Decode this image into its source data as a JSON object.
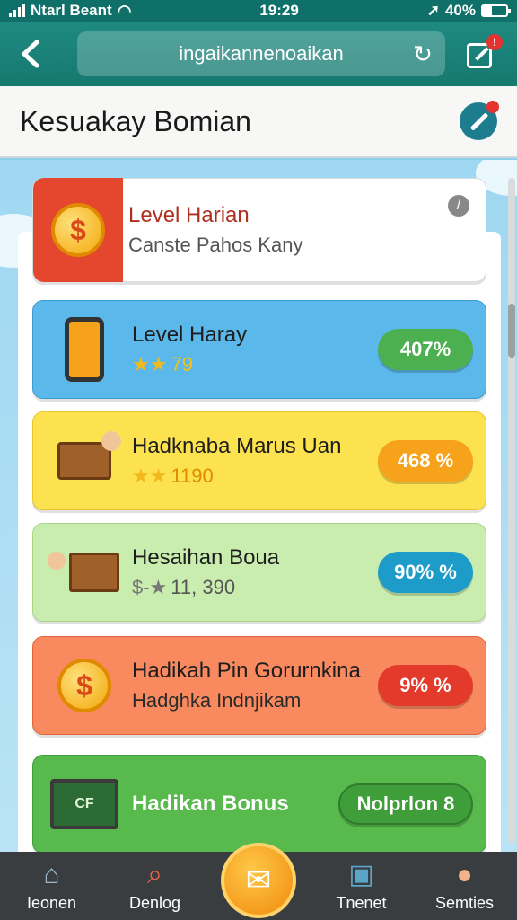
{
  "status_bar": {
    "carrier": "Ntarl Beant",
    "time": "19:29",
    "battery": "40%",
    "battery_level": 0.4
  },
  "browser": {
    "url": "ingaikannenoaikan"
  },
  "header": {
    "title": "Kesuakay  Bomian"
  },
  "cards": [
    {
      "name": "Level Harian",
      "sub": "Canste Pahos Kany",
      "badge": "",
      "color": "#ffffff",
      "pill_color": ""
    },
    {
      "name": "Level Haray",
      "stars": "★★",
      "sub": "79",
      "badge": "407%",
      "color": "#5bb8ea",
      "pill_color": "#4caf50"
    },
    {
      "name": "Hadknaba Marus Uan",
      "stars": "★★",
      "sub": "1190",
      "badge": "468 %",
      "color": "#fde24f",
      "pill_color": "#f7a21b"
    },
    {
      "name": "Hesaihan Boua",
      "stars": "$-★",
      "sub": "11, 390",
      "badge": "90% %",
      "color": "#c9edae",
      "pill_color": "#1d9bc9"
    },
    {
      "name": "Hadikah Pin  Gorurnkina",
      "stars": "",
      "sub": "Hadghka Indnjikam",
      "badge": "9% %",
      "color": "#f98a60",
      "pill_color": "#e43a2c"
    },
    {
      "name": "Hadikan Bonus",
      "stars": "",
      "sub": "",
      "badge": "Nolprlon 8",
      "color": "#58b94c",
      "pill_color": "#3f9e3a"
    }
  ],
  "card6_icon_text": "CF",
  "nav": [
    {
      "label": "Ieonen",
      "icon": "home-icon"
    },
    {
      "label": "Denlog",
      "icon": "search-icon"
    },
    {
      "label": "",
      "icon": "envelope-icon"
    },
    {
      "label": "Tnenet",
      "icon": "gift-icon"
    },
    {
      "label": "Semties",
      "icon": "profile-icon"
    }
  ]
}
